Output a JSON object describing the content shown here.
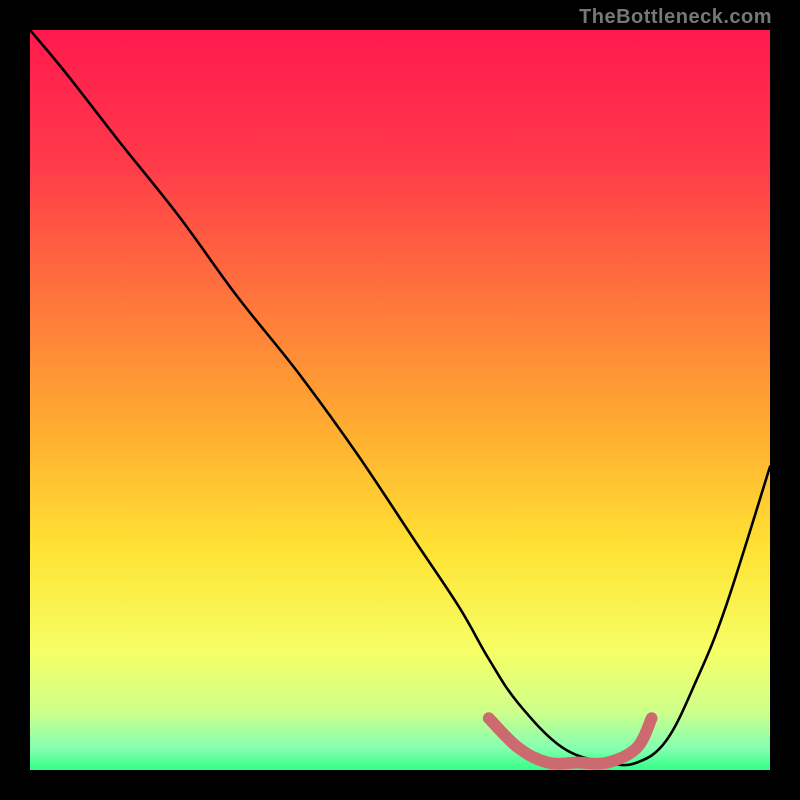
{
  "watermark": "TheBottleneck.com",
  "chart_data": {
    "type": "line",
    "title": "",
    "xlabel": "",
    "ylabel": "",
    "xlim": [
      0,
      100
    ],
    "ylim": [
      0,
      100
    ],
    "grid": false,
    "legend": false,
    "gradient_stops": [
      {
        "offset": 0,
        "color": "#ff1a4d"
      },
      {
        "offset": 18,
        "color": "#ff3a4a"
      },
      {
        "offset": 38,
        "color": "#ff7a3a"
      },
      {
        "offset": 55,
        "color": "#ffb030"
      },
      {
        "offset": 70,
        "color": "#ffe233"
      },
      {
        "offset": 84,
        "color": "#f6ff66"
      },
      {
        "offset": 92,
        "color": "#cfff8a"
      },
      {
        "offset": 97,
        "color": "#86ffb0"
      },
      {
        "offset": 100,
        "color": "#34ff88"
      }
    ],
    "series": [
      {
        "name": "bottleneck-curve",
        "color": "#000000",
        "x": [
          0,
          5,
          12,
          20,
          28,
          36,
          44,
          52,
          58,
          62,
          66,
          72,
          78,
          82,
          86,
          90,
          94,
          100
        ],
        "y": [
          100,
          94,
          85,
          75,
          64,
          54,
          43,
          31,
          22,
          15,
          9,
          3,
          1,
          1,
          4,
          12,
          22,
          41
        ]
      },
      {
        "name": "optimal-range-marker",
        "color": "#cc6a6f",
        "x": [
          62,
          66,
          70,
          74,
          78,
          82,
          84
        ],
        "y": [
          7,
          3,
          1,
          1,
          1,
          3,
          7
        ]
      }
    ]
  }
}
